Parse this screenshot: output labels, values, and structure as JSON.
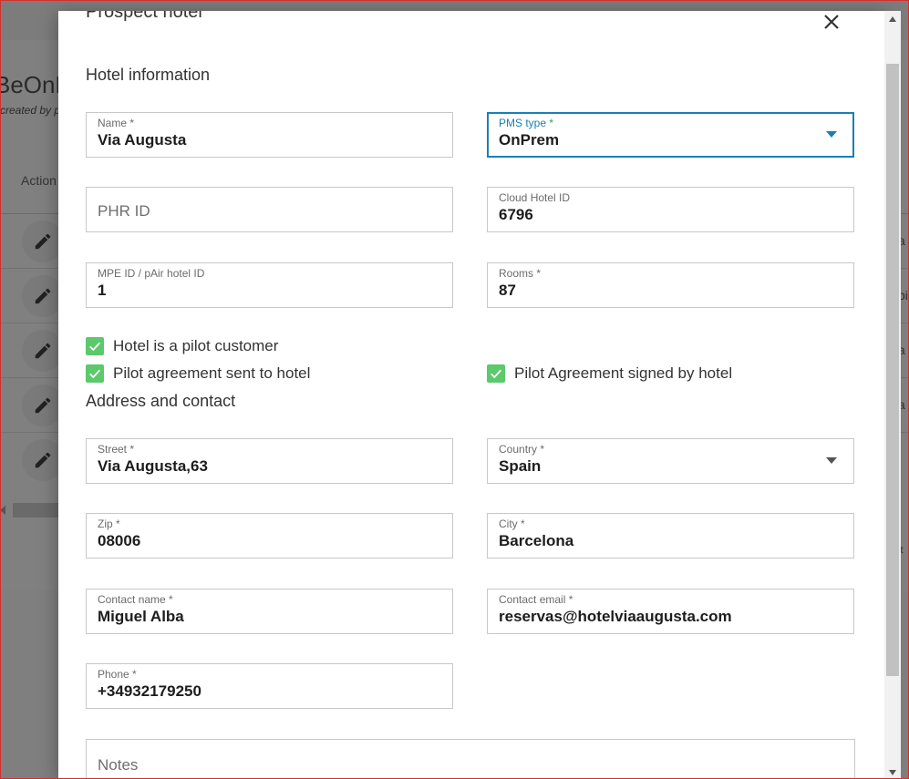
{
  "background": {
    "app_title_fragment": "BeOnP",
    "subtitle_fragment": "created by p",
    "actions_header": "Action",
    "right_fragments": [
      "a",
      "pi",
      "a",
      "a",
      "lt"
    ]
  },
  "modal": {
    "title": "Prospect hotel",
    "sections": {
      "hotel_information": "Hotel information",
      "address_and_contact": "Address and contact"
    },
    "fields": {
      "name": {
        "label": "Name *",
        "value": "Via Augusta"
      },
      "pms_type": {
        "label": "PMS type",
        "required_mark": "*",
        "value": "OnPrem"
      },
      "phr_id": {
        "placeholder": "PHR ID"
      },
      "cloud_hotel_id": {
        "label": "Cloud Hotel ID",
        "value": "6796"
      },
      "mpe_id": {
        "label": "MPE ID / pAir hotel ID",
        "value": "1"
      },
      "rooms": {
        "label": "Rooms *",
        "value": "87"
      },
      "street": {
        "label": "Street *",
        "value": "Via Augusta,63"
      },
      "country": {
        "label": "Country *",
        "value": "Spain"
      },
      "zip": {
        "label": "Zip *",
        "value": "08006"
      },
      "city": {
        "label": "City *",
        "value": "Barcelona"
      },
      "contact_name": {
        "label": "Contact name *",
        "value": "Miguel Alba"
      },
      "contact_email": {
        "label": "Contact email *",
        "value": "reservas@hotelviaaugusta.com"
      },
      "phone": {
        "label": "Phone *",
        "value": "+34932179250"
      },
      "notes": {
        "placeholder": "Notes"
      }
    },
    "checkboxes": {
      "pilot_customer": {
        "label": "Hotel is a pilot customer",
        "checked": true
      },
      "agreement_sent": {
        "label": "Pilot agreement sent to hotel",
        "checked": true
      },
      "agreement_signed": {
        "label": "Pilot Agreement signed by hotel",
        "checked": true
      }
    }
  },
  "colors": {
    "focus_accent": "#1a7fb5",
    "checkbox_green": "#5cc96c",
    "required_green": "#3aa64a",
    "frame_red": "#d0312d"
  }
}
